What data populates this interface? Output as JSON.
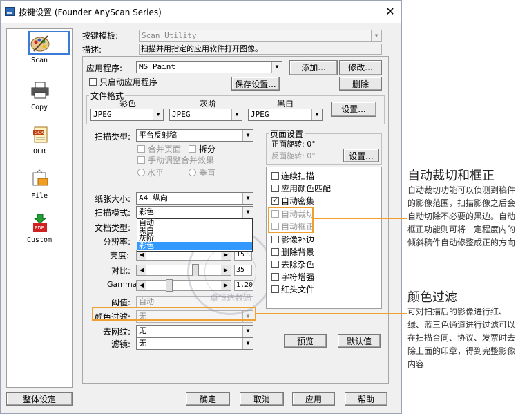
{
  "window": {
    "title": "按键设置 (Founder AnyScan Series)"
  },
  "sidebar": {
    "items": [
      {
        "label": "Scan",
        "icon": "palette-icon"
      },
      {
        "label": "Copy",
        "icon": "printer-icon"
      },
      {
        "label": "OCR",
        "icon": "ocr-icon"
      },
      {
        "label": "File",
        "icon": "folder-icon"
      },
      {
        "label": "Custom",
        "icon": "pdf-icon"
      }
    ]
  },
  "template": {
    "label": "按键模板:",
    "value": "Scan Utility"
  },
  "description": {
    "label": "描述:",
    "value": "扫描并用指定的应用软件打开图像。"
  },
  "app": {
    "label": "应用程序:",
    "value": "MS Paint",
    "add": "添加...",
    "edit": "修改...",
    "delete": "删除",
    "autostart": "只启动应用程序",
    "save_settings": "保存设置..."
  },
  "file_format": {
    "title": "文件格式",
    "color_label": "彩色",
    "gray_label": "灰阶",
    "bw_label": "黑白",
    "color_value": "JPEG",
    "gray_value": "JPEG",
    "bw_value": "JPEG",
    "settings": "设置..."
  },
  "scan_type": {
    "label": "扫描类型:",
    "value": "平台反射稿",
    "merge_pages": "合并页面",
    "split": "拆分",
    "manual_merge": "手动调整合并效果",
    "horizontal": "水平",
    "vertical": "垂直"
  },
  "page_settings": {
    "title": "页面设置",
    "front": "正面旋转: 0°",
    "back": "反面旋转: 0°",
    "settings": "设置..."
  },
  "params": {
    "paper_size_label": "纸张大小:",
    "paper_size_value": "A4 纵向",
    "scan_mode_label": "扫描模式:",
    "scan_mode_value": "彩色",
    "doc_type_label": "文档类型:",
    "resolution_label": "分辨率:",
    "brightness_label": "亮度:",
    "brightness_value": "15",
    "contrast_label": "对比:",
    "contrast_value": "35",
    "gamma_label": "Gamma:",
    "gamma_value": "1.20",
    "threshold_label": "阈值:",
    "threshold_value": "自动",
    "color_filter_label": "颜色过滤:",
    "color_filter_value": "无",
    "descreen_label": "去网纹:",
    "descreen_value": "无",
    "filter_label": "滤镜:",
    "filter_value": "无"
  },
  "scan_mode_options": [
    "自动",
    "黑白",
    "灰阶",
    "彩色"
  ],
  "options": {
    "continuous": "连续扫描",
    "color_match": "应用颜色匹配",
    "auto_density": "自动密集",
    "auto_crop": "自动裁切",
    "auto_deskew": "自动框正",
    "image_fill": "影像补边",
    "remove_blank": "删除背景",
    "despeckle": "去除杂色",
    "char_enhance": "字符增强",
    "red_file": "红头文件"
  },
  "buttons": {
    "preview": "预览",
    "default": "默认值",
    "overall": "整体设定",
    "ok": "确定",
    "cancel": "取消",
    "apply": "应用",
    "help": "帮助"
  },
  "watermark_text": "卓恒达数码",
  "annotations": [
    {
      "title": "自动裁切和框正",
      "body": "自动裁切功能可以侦测到稿件的影像范围，扫描影像之后会自动切除不必要的黑边。自动框正功能则可将一定程度内的倾斜稿件自动修整成正的方向"
    },
    {
      "title": "颜色过滤",
      "body": "可对扫描后的影像进行红、绿、蓝三色通道进行过滤可以在扫描合同、协议、发票时去除上面的印章，得到完整影像内容"
    }
  ],
  "colors": {
    "highlight": "#f0a030",
    "selection": "#3399ff"
  }
}
